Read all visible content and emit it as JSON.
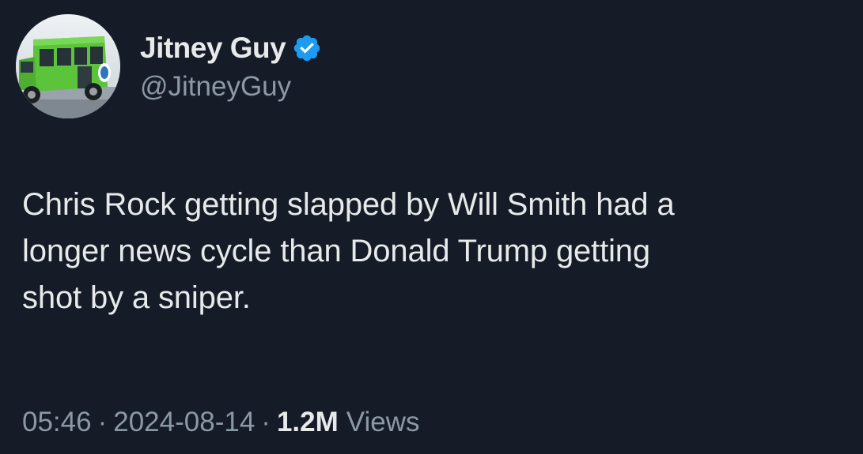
{
  "user": {
    "display_name": "Jitney Guy",
    "handle": "@JitneyGuy",
    "verified": true,
    "avatar_icon": "bus-avatar"
  },
  "tweet": {
    "text": "Chris Rock getting slapped by Will Smith had a\nlonger news cycle than Donald Trump getting\nshot by a sniper."
  },
  "meta": {
    "time": "05:46",
    "separator": "·",
    "date": "2024-08-14",
    "views_count": "1.2M",
    "views_label": "Views"
  },
  "colors": {
    "background": "#151c28",
    "text_primary": "#e7e9ea",
    "text_secondary": "#8b98a5",
    "verified_badge": "#1d9bf0"
  }
}
